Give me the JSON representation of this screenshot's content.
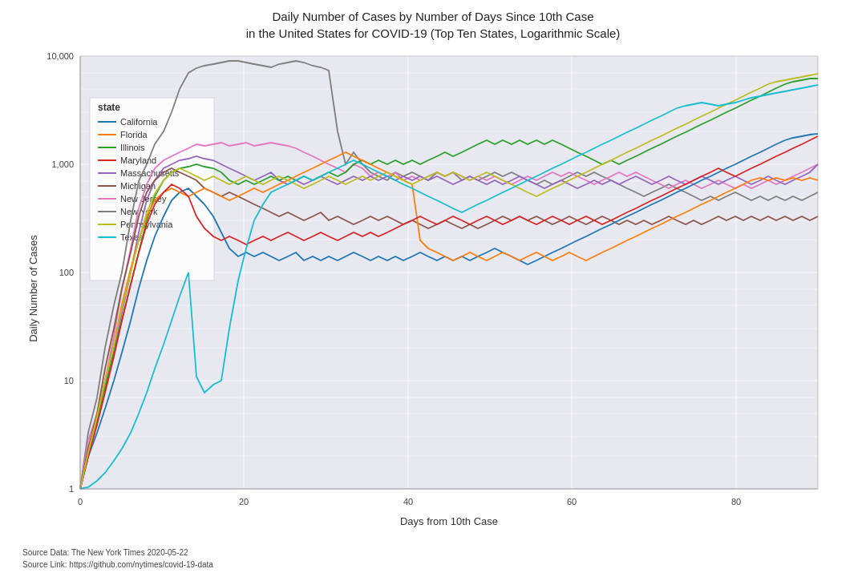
{
  "title": {
    "line1": "Daily Number of Cases by Number of Days Since 10th Case",
    "line2": "in the United States for COVID-19 (Top Ten States, Logarithmic Scale)"
  },
  "axes": {
    "x_label": "Days from 10th Case",
    "y_label": "Daily Number of Cases",
    "x_ticks": [
      "0",
      "20",
      "40",
      "60",
      "80"
    ],
    "y_ticks": [
      "1",
      "10",
      "100",
      "1,000",
      "10,000"
    ]
  },
  "legend": {
    "title": "state",
    "items": [
      {
        "label": "California",
        "color": "#1f77b4"
      },
      {
        "label": "Florida",
        "color": "#ff7f0e"
      },
      {
        "label": "Illinois",
        "color": "#2ca02c"
      },
      {
        "label": "Maryland",
        "color": "#d62728"
      },
      {
        "label": "Massachusetts",
        "color": "#9467bd"
      },
      {
        "label": "Michigan",
        "color": "#8c564b"
      },
      {
        "label": "New Jersey",
        "color": "#e377c2"
      },
      {
        "label": "New York",
        "color": "#7f7f7f"
      },
      {
        "label": "Pennsylvania",
        "color": "#bcbd22"
      },
      {
        "label": "Texas",
        "color": "#17becf"
      }
    ]
  },
  "footer": {
    "source_data": "Source Data: The New York Times 2020-05-22",
    "source_link": "Source Link: https://github.com/nytimes/covid-19-data"
  }
}
